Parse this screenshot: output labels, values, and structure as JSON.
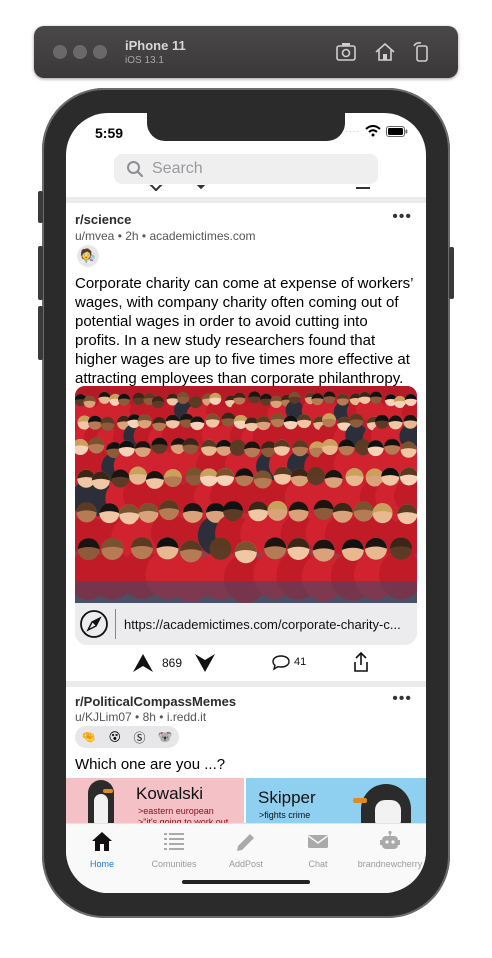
{
  "simulator": {
    "device": "iPhone 11",
    "os": "iOS 13.1"
  },
  "status": {
    "time": "5:59"
  },
  "search": {
    "placeholder": "Search"
  },
  "posts": [
    {
      "subreddit": "r/science",
      "author": "u/mvea",
      "age": "2h",
      "domain": "academictimes.com",
      "title": "Corporate charity can come at expense of workers' wages, with company charity often coming out of potential wages in order to avoid cutting into profits. In a new study researchers found that higher wages are up to five times more effective at attracting employees than corporate philanthropy.",
      "title_lines": [
        "Corporate charity can come at expense of workers’",
        "wages, with company charity often coming out of",
        "potential wages in order to avoid cutting into",
        "profits. In a new study researchers found that",
        "higher wages are up to five times more effective at",
        "attracting employees than corporate philanthropy."
      ],
      "link": "https://academictimes.com/corporate-charity-c...",
      "score": "869",
      "comments": "41"
    },
    {
      "subreddit": "r/PoliticalCompassMemes",
      "author": "u/KJLim07",
      "age": "8h",
      "domain": "i.redd.it",
      "title": "Which one are you ...?",
      "meme": {
        "left_name": "Kowalski",
        "left_line1": ">eastern european",
        "left_line2": ">\"it's going to work out",
        "right_name": "Skipper",
        "right_line1": ">fights crime"
      }
    }
  ],
  "tabs": [
    {
      "label": "Home",
      "icon": "home-icon",
      "active": true
    },
    {
      "label": "Comunities",
      "icon": "list-icon",
      "active": false
    },
    {
      "label": "AddPost",
      "icon": "pencil-icon",
      "active": false
    },
    {
      "label": "Chat",
      "icon": "mail-icon",
      "active": false
    },
    {
      "label": "brandnewcherry",
      "icon": "robot-icon",
      "active": false
    }
  ],
  "colors": {
    "accent": "#1f7ae0",
    "inactive": "#9b9b9b",
    "shirt_red": "#c61f2c"
  }
}
